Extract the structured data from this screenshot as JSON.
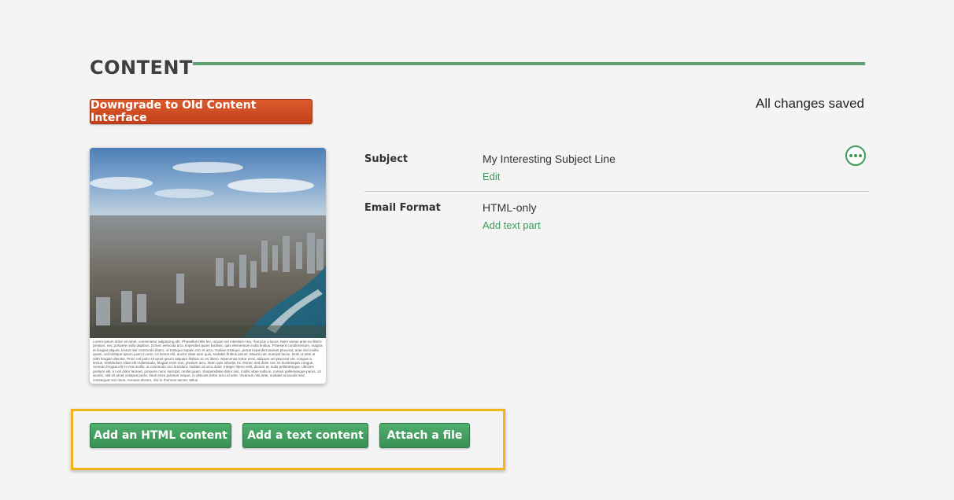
{
  "section": {
    "title": "CONTENT"
  },
  "toolbar": {
    "downgrade_label": "Downgrade to Old Content Interface",
    "save_status": "All changes saved"
  },
  "preview": {
    "body_text": "Lorem ipsum dolor sit amet, consectetur adipiscing elit. Phasellus felis leo, ornare vel interdum non, rhoncus a lacus. Nam varius ante eu libero pretium, nec posuere nulla dapibus. Donec vehicula arcu imperdiet quam facilisis, quis elementum nulla finibus. Praesent condimentum, magna et feugiat aliquet, lectus nisl commodo libero, id tristique sapien orci et arcu. Nullam tristique, purus imperdiet laoreet placerat, ante nisl mollis quam, vel tristique ipsum justo in sem. Ut lectus elit, auctor vitae sem quis, sodales finibus ipsum. Mauris nec suscipit lacus. Duis ut ante at nibh feugiat ultricies. Proin vel justo sit amet ipsum aliquam finibus ac eu libero. Maecenas tortor eros, aliquam vel placerat vel, congue a lectus. Vestibulum vitae elit malesuada, feugiat enim non, pretium arcu. Nam quis lobortis mi. Donec sed dolor nec mi scelerisque congue. Aenean feugiat elit in erat mollis, ut commodo orci tincidunt. Nullam at arcu dolor. Integer libero velit, dictum ac nulla pellentesque, ultricies pretium elit. In vel dolor laoreet, posuere nunc suscipit, mollis quam. Suspendisse dolor nisi, mollis vitae nulla in, cursus pellentesque purus. Ut iaculis, nisl sit amet volutpat porta, risus enim pulvinar neque, in ultricies tortor arcu id ante. Vivamus nisi ante, sodales at iaculis sed, consequat non risus. Aenean dictum, nisl in rhoncus auctor, tellus"
  },
  "subject": {
    "label": "Subject",
    "value": "My Interesting Subject Line",
    "edit_link": "Edit"
  },
  "email_format": {
    "label": "Email Format",
    "value": "HTML-only",
    "add_link": "Add text part"
  },
  "actions": {
    "add_html": "Add an HTML content",
    "add_text": "Add a text content",
    "attach_file": "Attach a file"
  },
  "colors": {
    "accent_green": "#3e9a5b",
    "downgrade_orange": "#c94a1f",
    "highlight_yellow": "#f1b51a"
  },
  "icons": {
    "more": "more-horizontal-icon"
  }
}
